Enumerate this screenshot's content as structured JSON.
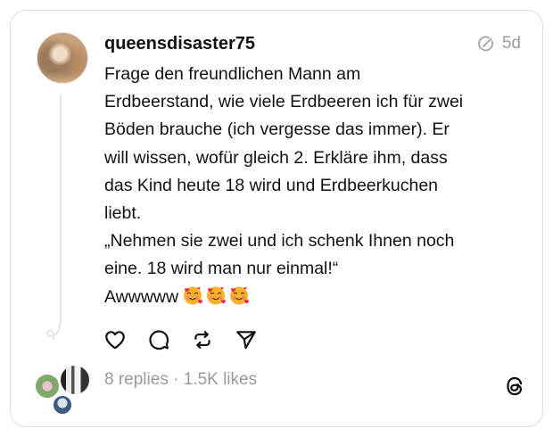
{
  "post": {
    "username": "queensdisaster75",
    "time": "5d",
    "lines": [
      "Frage den freundlichen Mann am",
      "Erdbeerstand, wie viele Erdbeeren ich für zwei",
      "Böden brauche (ich vergesse  das immer). Er",
      "will  wissen, wofür gleich 2. Erkläre ihm, dass",
      "das Kind heute 18 wird und Erdbeerkuchen",
      "liebt.",
      "„Nehmen sie zwei und ich schenk Ihnen noch",
      "eine. 18 wird man nur einmal!“",
      "Awwwww"
    ],
    "emoji_name": "smiling-face-with-hearts",
    "emoji_count": 3
  },
  "stats": {
    "replies": "8 replies",
    "separator": "·",
    "likes": "1.5K likes"
  },
  "icons": {
    "like": "heart-icon",
    "reply": "comment-icon",
    "repost": "repost-icon",
    "share": "send-icon",
    "edit": "edited-icon",
    "brand": "threads-logo-icon"
  },
  "colors": {
    "text": "#121212",
    "muted": "#9a9a9a",
    "border": "#dcdcdc"
  }
}
